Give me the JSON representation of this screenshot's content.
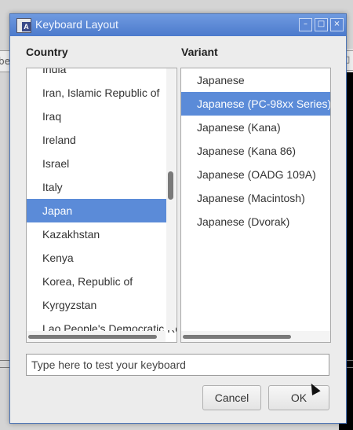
{
  "background": {
    "left_tab_text": "bel",
    "right_tab_text": "□"
  },
  "dialog": {
    "title": "Keyboard Layout",
    "titlebar_buttons": {
      "minimize": "–",
      "maximize": "□",
      "close": "×"
    },
    "country_header": "Country",
    "variant_header": "Variant",
    "countries": [
      "India",
      "Iran, Islamic Republic of",
      "Iraq",
      "Ireland",
      "Israel",
      "Italy",
      "Japan",
      "Kazakhstan",
      "Kenya",
      "Korea, Republic of",
      "Kyrgyzstan",
      "Lao People's Democratic Republic"
    ],
    "selected_country": "Japan",
    "variants": [
      "Japanese",
      "Japanese (PC-98xx Series)",
      "Japanese (Kana)",
      "Japanese (Kana 86)",
      "Japanese (OADG 109A)",
      "Japanese (Macintosh)",
      "Japanese (Dvorak)"
    ],
    "selected_variant": "Japanese (PC-98xx Series)",
    "test_input_placeholder": "Type here to test your keyboard",
    "cancel_label": "Cancel",
    "ok_label": "OK"
  },
  "colors": {
    "titlebar": "#5c88d6",
    "selection": "#5b8bd8",
    "window_bg": "#ececec"
  }
}
